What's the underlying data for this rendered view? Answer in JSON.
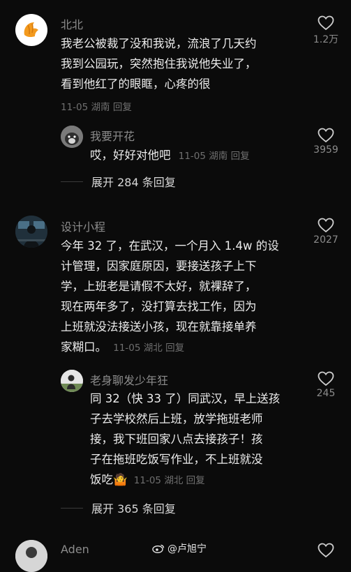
{
  "comments": [
    {
      "author": "北北",
      "lines": [
        "我老公被裁了没和我说，流浪了几天约",
        "我到公园玩，突然抱住我说他失业了，",
        "看到他红了的眼眶，心疼的很"
      ],
      "date": "11-05",
      "location": "湖南",
      "reply_label": "回复",
      "likes": "1.2万",
      "replies": [
        {
          "author": "我要开花",
          "text": "哎，好好对他吧",
          "date": "11-05",
          "location": "湖南",
          "reply_label": "回复",
          "likes": "3959"
        }
      ],
      "expand_label": "展开 284 条回复"
    },
    {
      "author": "设计小程",
      "lines": [
        "今年 32 了，在武汉，一个月入 1.4w 的设",
        "计管理，因家庭原因，要接送孩子上下",
        "学，上班老是请假不太好，就裸辞了，",
        "现在两年多了，没打算去找工作，因为",
        "上班就没法接送小孩，现在就靠接单养",
        "家糊口。"
      ],
      "date": "11-05",
      "location": "湖北",
      "reply_label": "回复",
      "likes": "2027",
      "replies": [
        {
          "author": "老身聊发少年狂",
          "lines": [
            "同 32（快 33 了）同武汉，早上送孩",
            "子去学校然后上班，放学拖班老师",
            "接，我下班回家八点去接孩子！孩",
            "子在拖班吃饭写作业，不上班就没",
            "饭吃"
          ],
          "emoji": "🤷",
          "date": "11-05",
          "location": "湖北",
          "reply_label": "回复",
          "likes": "245"
        }
      ],
      "expand_label": "展开 365 条回复"
    },
    {
      "author": "Aden"
    }
  ],
  "watermark": "@卢旭宁",
  "icons": {
    "like": "heart-outline-icon",
    "weibo": "weibo-logo-icon"
  }
}
